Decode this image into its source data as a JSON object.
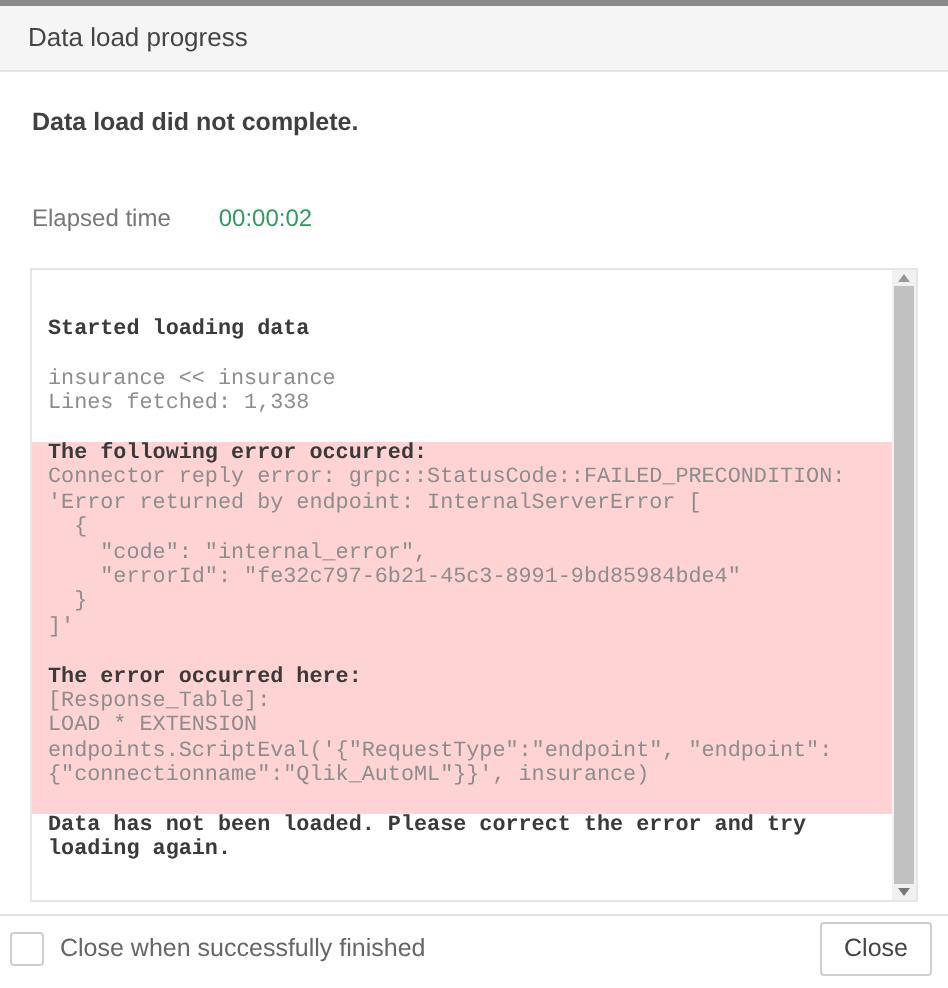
{
  "dialog": {
    "title": "Data load progress"
  },
  "message": "Data load did not complete.",
  "elapsed": {
    "label": "Elapsed time",
    "value": "00:00:02"
  },
  "log": {
    "sections": [
      {
        "kind": "info",
        "lines": [
          {
            "text": "Started loading data",
            "bold": true
          }
        ]
      },
      {
        "kind": "info",
        "lines": [
          {
            "text": "insurance << insurance",
            "bold": false
          },
          {
            "text": "Lines fetched: 1,338",
            "bold": false
          }
        ]
      },
      {
        "kind": "error",
        "lines": [
          {
            "text": "The following error occurred:",
            "bold": true
          },
          {
            "text": "Connector reply error: grpc::StatusCode::FAILED_PRECONDITION:",
            "bold": false
          },
          {
            "text": "'Error returned by endpoint: InternalServerError [",
            "bold": false
          },
          {
            "text": "  {",
            "bold": false
          },
          {
            "text": "    \"code\": \"internal_error\",",
            "bold": false
          },
          {
            "text": "    \"errorId\": \"fe32c797-6b21-45c3-8991-9bd85984bde4\"",
            "bold": false
          },
          {
            "text": "  }",
            "bold": false
          },
          {
            "text": "]'",
            "bold": false
          }
        ]
      },
      {
        "kind": "error",
        "lines": [
          {
            "text": "The error occurred here:",
            "bold": true
          },
          {
            "text": "[Response_Table]:",
            "bold": false
          },
          {
            "text": "LOAD * EXTENSION",
            "bold": false
          },
          {
            "text": "endpoints.ScriptEval('{\"RequestType\":\"endpoint\", \"endpoint\":",
            "bold": false
          },
          {
            "text": "{\"connectionname\":\"Qlik_AutoML\"}}', insurance)",
            "bold": false
          }
        ]
      },
      {
        "kind": "info",
        "lines": [
          {
            "text": "Data has not been loaded. Please correct the error and try",
            "bold": true
          },
          {
            "text": "loading again.",
            "bold": true
          }
        ]
      }
    ]
  },
  "footer": {
    "checkbox": {
      "label": "Close when successfully finished",
      "checked": false
    },
    "button": "Close"
  }
}
